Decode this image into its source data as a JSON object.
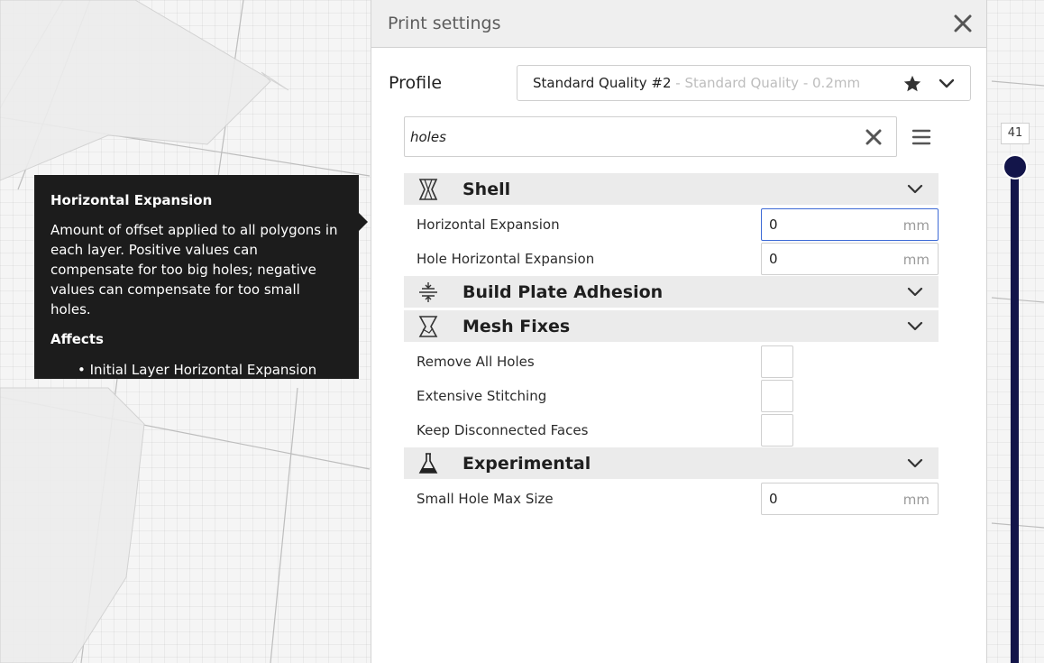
{
  "panel": {
    "title": "Print settings",
    "profile_label": "Profile",
    "profile_name": "Standard Quality #2",
    "profile_sub": " - Standard Quality - 0.2mm"
  },
  "search": {
    "value": "holes"
  },
  "tooltip": {
    "title": "Horizontal Expansion",
    "description": "Amount of offset applied to all polygons in each layer. Positive values can compensate for too big holes; negative values can compensate for too small holes.",
    "affects_label": "Affects",
    "affects_items": [
      "• Initial Layer Horizontal Expansion"
    ]
  },
  "categories": {
    "shell": {
      "label": "Shell"
    },
    "adhesion": {
      "label": "Build Plate Adhesion"
    },
    "mesh_fixes": {
      "label": "Mesh Fixes"
    },
    "experimental": {
      "label": "Experimental"
    }
  },
  "settings": {
    "horizontal_expansion": {
      "label": "Horizontal Expansion",
      "value": "0",
      "unit": "mm"
    },
    "hole_horizontal_expansion": {
      "label": "Hole Horizontal Expansion",
      "value": "0",
      "unit": "mm"
    },
    "remove_all_holes": {
      "label": "Remove All Holes",
      "checked": false
    },
    "extensive_stitching": {
      "label": "Extensive Stitching",
      "checked": false
    },
    "keep_disconnected_faces": {
      "label": "Keep Disconnected Faces",
      "checked": false
    },
    "small_hole_max_size": {
      "label": "Small Hole Max Size",
      "value": "0",
      "unit": "mm"
    }
  },
  "layer_slider": {
    "value": "41"
  },
  "colors": {
    "slider": "#13154a",
    "active_input_border": "#3d6ad6",
    "tooltip_bg": "#1c1c1c"
  },
  "icons": {
    "close": "close-icon",
    "favorite": "star-icon",
    "dropdown": "chevron-down-icon",
    "search_clear": "close-icon",
    "menu": "hamburger-menu-icon",
    "shell": "shell-icon",
    "adhesion": "adhesion-icon",
    "mesh_fixes": "mesh-fixes-icon",
    "experimental": "flask-icon"
  }
}
